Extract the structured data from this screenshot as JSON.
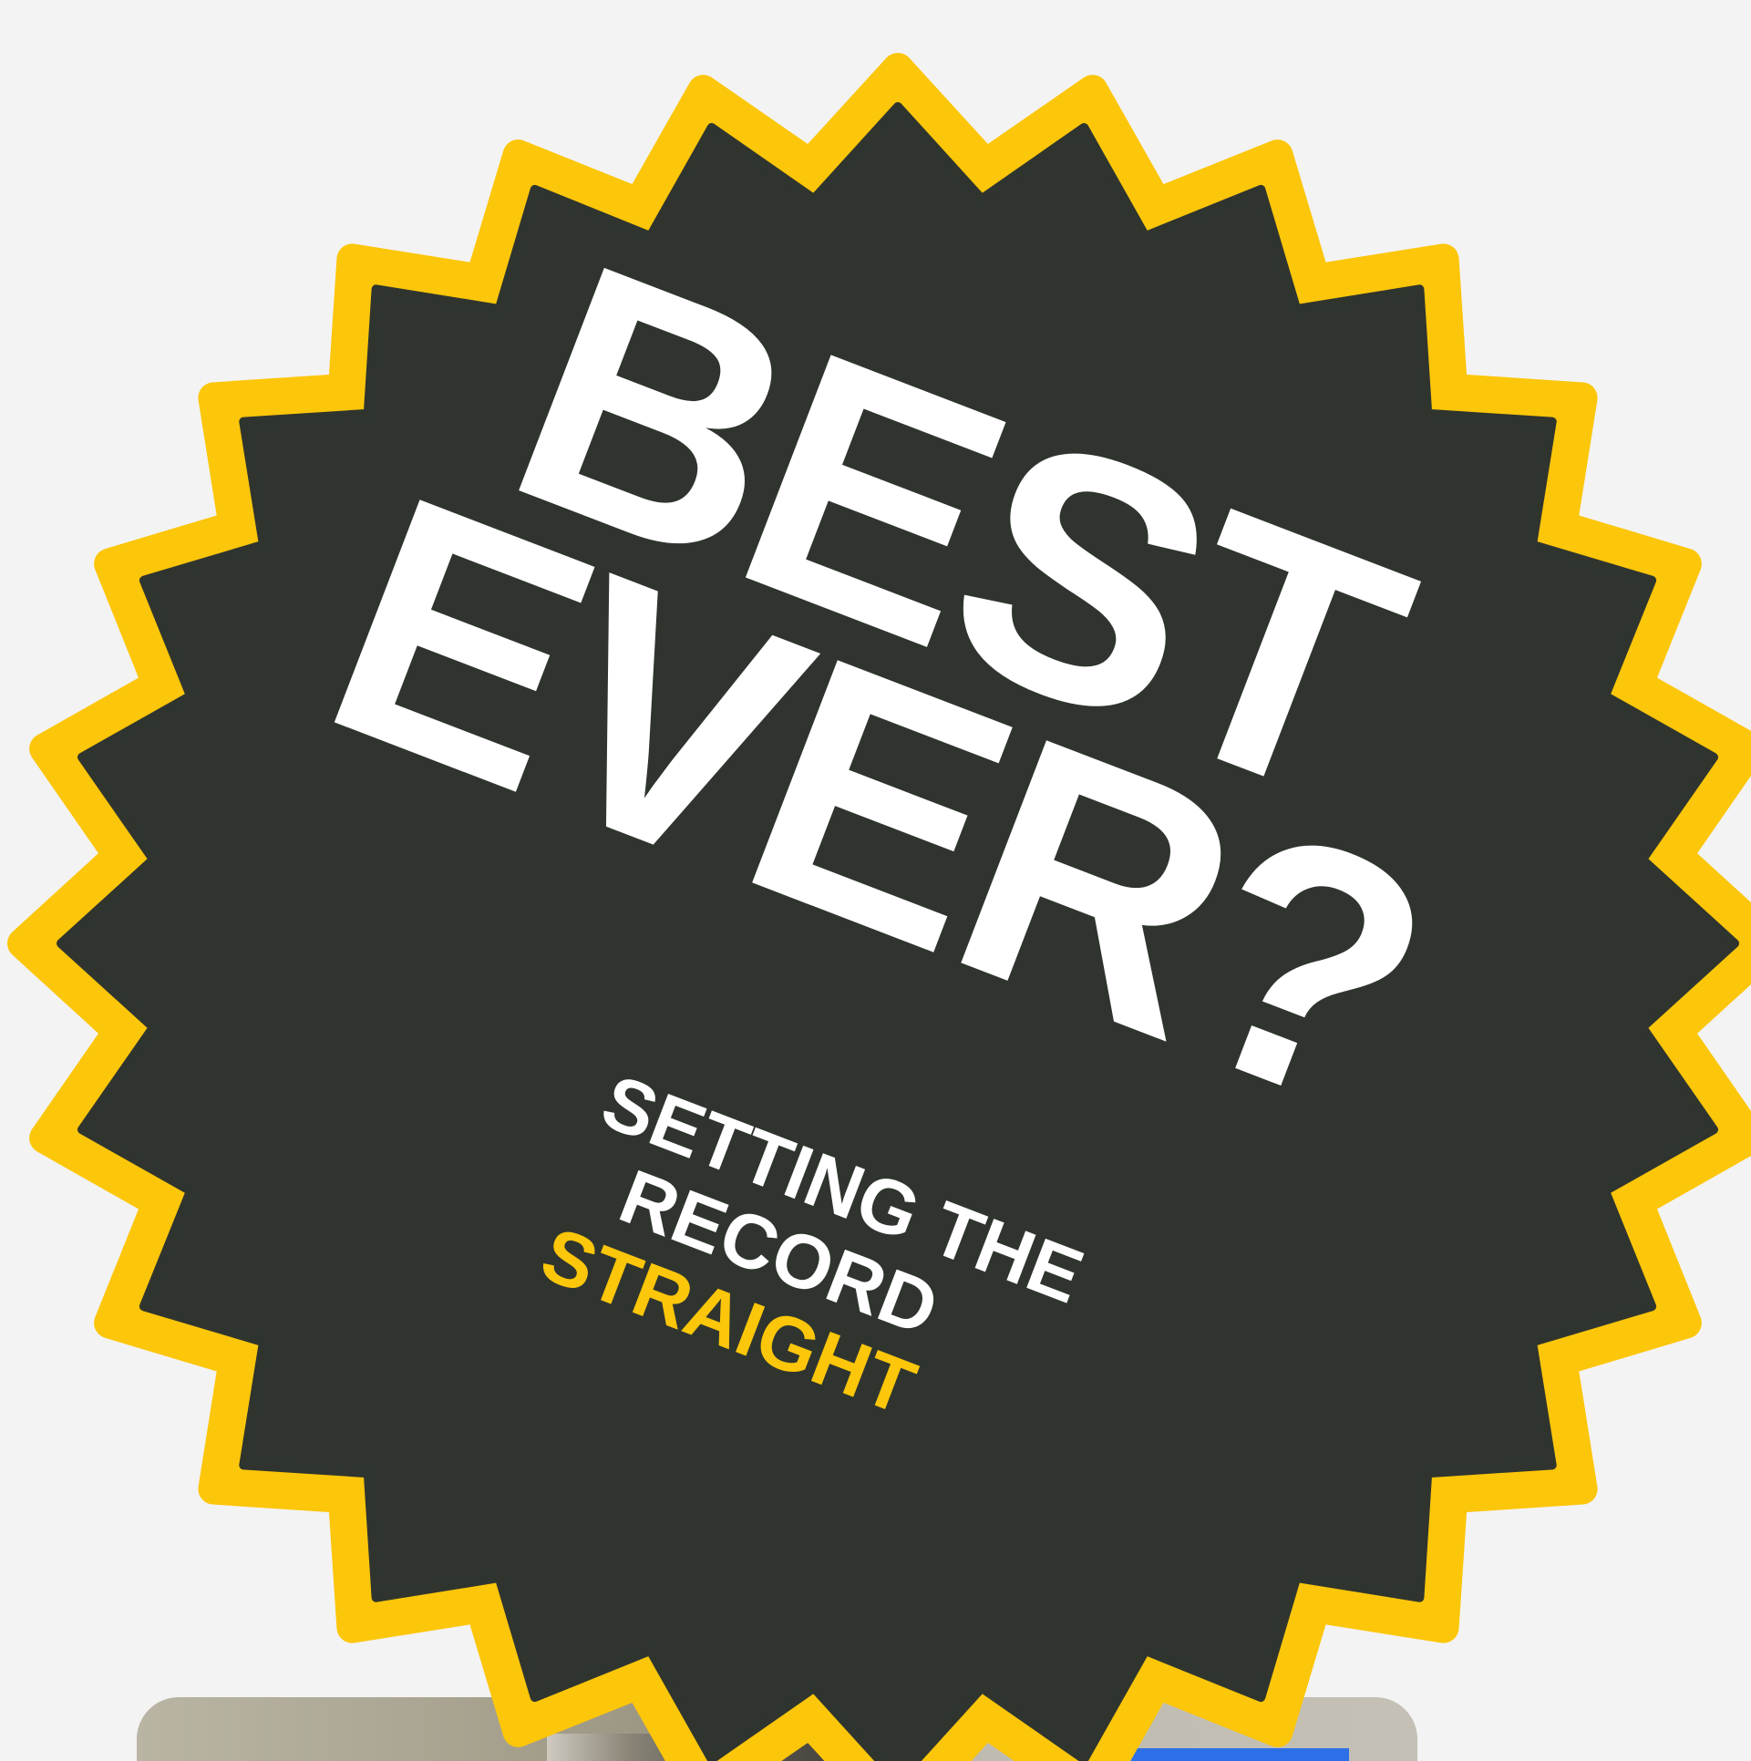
{
  "badge": {
    "headline_line1": "BEST",
    "headline_line2": "EVER?",
    "subtitle_line1": "SETTING THE",
    "subtitle_line2": "RECORD",
    "subtitle_line3": "STRAIGHT"
  },
  "colors": {
    "background": "#f3f3f3",
    "badge_fill": "#2f352e",
    "badge_border": "#fcc60a",
    "headline": "#ffffff",
    "accent": "#fcc60a"
  }
}
